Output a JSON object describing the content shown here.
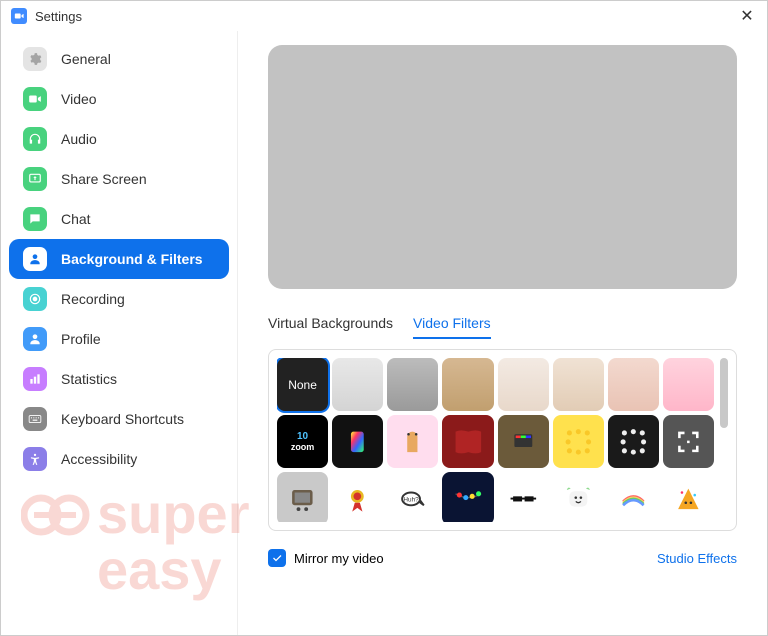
{
  "window": {
    "title": "Settings"
  },
  "sidebar": {
    "items": [
      {
        "label": "General"
      },
      {
        "label": "Video"
      },
      {
        "label": "Audio"
      },
      {
        "label": "Share Screen"
      },
      {
        "label": "Chat"
      },
      {
        "label": "Background & Filters"
      },
      {
        "label": "Recording"
      },
      {
        "label": "Profile"
      },
      {
        "label": "Statistics"
      },
      {
        "label": "Keyboard Shortcuts"
      },
      {
        "label": "Accessibility"
      }
    ],
    "active_index": 5
  },
  "tabs": {
    "virtual_bg": "Virtual Backgrounds",
    "video_filters": "Video Filters",
    "active": "video_filters"
  },
  "filters": {
    "none_label": "None",
    "selected_index": 0
  },
  "footer": {
    "mirror_label": "Mirror my video",
    "mirror_checked": true,
    "studio_effects": "Studio Effects"
  },
  "watermark": {
    "line1": "super",
    "line2": "easy"
  }
}
